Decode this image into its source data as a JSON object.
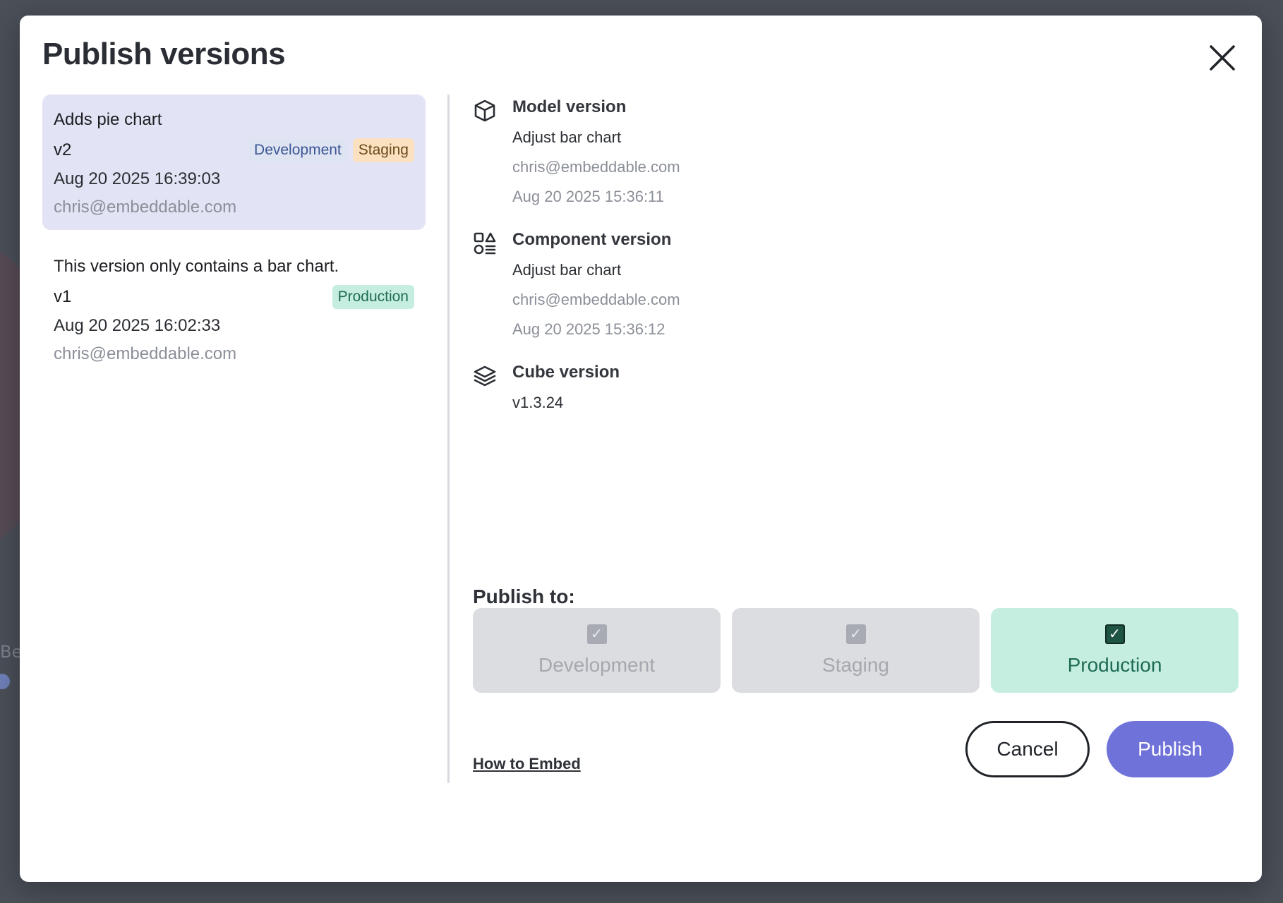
{
  "background": {
    "partial_text": "Bea"
  },
  "modal": {
    "title": "Publish versions",
    "close_icon": "close-icon"
  },
  "versions": [
    {
      "description": "Adds pie chart",
      "version": "v2",
      "badges": [
        "Development",
        "Staging"
      ],
      "date": "Aug 20 2025 16:39:03",
      "email": "chris@embeddable.com",
      "selected": true
    },
    {
      "description": "This version only contains a bar chart.",
      "version": "v1",
      "badges": [
        "Production"
      ],
      "date": "Aug 20 2025 16:02:33",
      "email": "chris@embeddable.com",
      "selected": false
    }
  ],
  "details": {
    "model": {
      "icon": "cube-icon",
      "title": "Model version",
      "description": "Adjust bar chart",
      "email": "chris@embeddable.com",
      "date": "Aug 20 2025 15:36:11"
    },
    "component": {
      "icon": "components-icon",
      "title": "Component version",
      "description": "Adjust bar chart",
      "email": "chris@embeddable.com",
      "date": "Aug 20 2025 15:36:12"
    },
    "cube": {
      "icon": "layers-icon",
      "title": "Cube version",
      "value": "v1.3.24"
    }
  },
  "publish": {
    "heading": "Publish to:",
    "targets": [
      {
        "label": "Development",
        "checked": true,
        "disabled": true
      },
      {
        "label": "Staging",
        "checked": true,
        "disabled": true
      },
      {
        "label": "Production",
        "checked": true,
        "disabled": false
      }
    ],
    "how_to_embed": "How to Embed",
    "cancel_label": "Cancel",
    "publish_label": "Publish"
  },
  "colors": {
    "accent": "#6f72d8",
    "selected_card": "#e2e3f4",
    "production": "#c5eee0",
    "staging": "#fbe1c0",
    "development": "#dfe4f3"
  }
}
